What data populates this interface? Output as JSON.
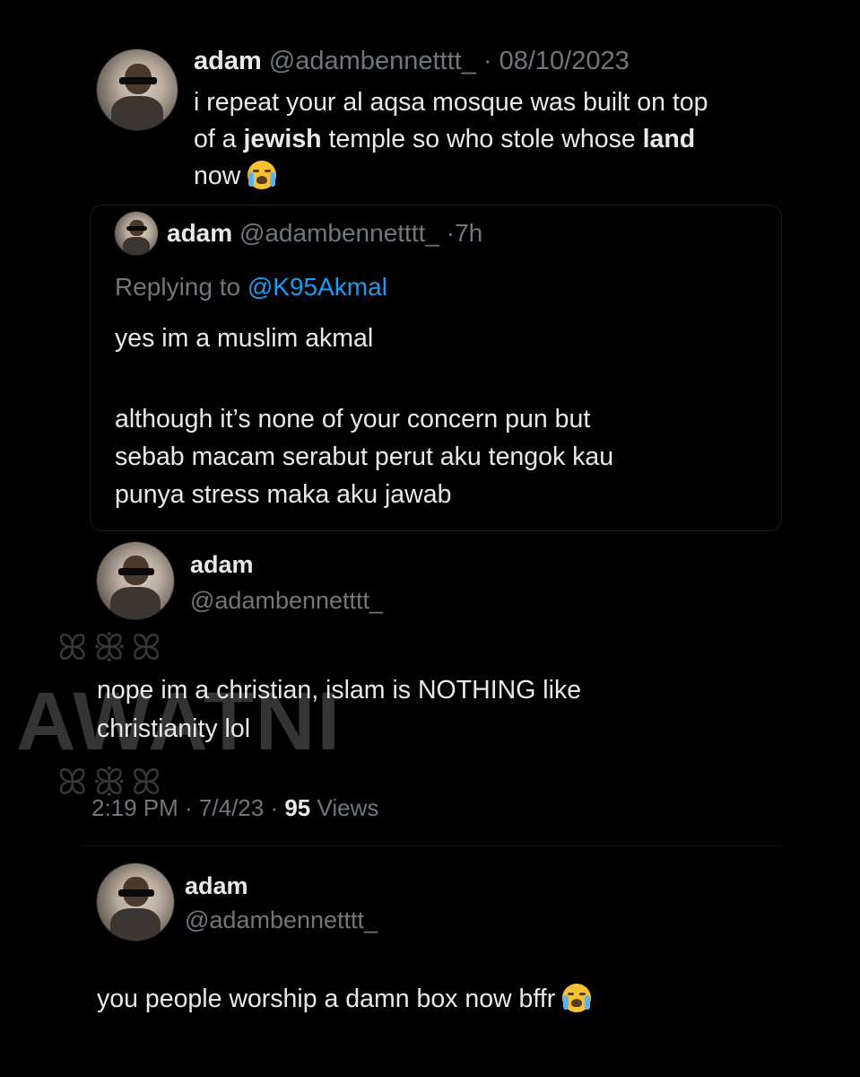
{
  "post1": {
    "name": "adam",
    "handle": "@adambennetttt_",
    "date_sep": "·",
    "date": "08/10/2023",
    "line1": "i repeat your al aqsa mosque was built on top",
    "line2_a": "of a ",
    "line2_b": "jewish",
    "line2_c": " temple so who stole whose ",
    "line2_d": "land",
    "line3": "now",
    "emoji_icon": "loudly-crying-face-icon"
  },
  "quoted": {
    "name": "adam",
    "handle": "@adambennetttt_",
    "time_sep": "·",
    "time": "7h",
    "replying_to_label": "Replying to",
    "replying_to_handle": "@K95Akmal",
    "line1": "yes im a muslim akmal",
    "line2": "although it’s none of your concern pun but",
    "line3": "sebab macam serabut perut aku tengok kau",
    "line4": "punya stress maka aku jawab"
  },
  "post2": {
    "name": "adam",
    "handle": "@adambennetttt_",
    "line1": "nope im a christian, islam is NOTHING like",
    "line2": "christianity lol",
    "meta_time": "2:19 PM · 7/4/23 · ",
    "views_count": "95",
    "views_label": " Views"
  },
  "post3": {
    "name": "adam",
    "handle": "@adambennetttt_",
    "text": "you people worship a damn box now bffr",
    "emoji_icon": "loudly-crying-face-icon"
  },
  "watermark": {
    "text": "AWATNI",
    "ornament": "ꕤꕥꕤ"
  },
  "colors": {
    "background": "#000000",
    "text": "#e7e9ea",
    "muted": "#71767b",
    "link": "#1d9bf0"
  }
}
